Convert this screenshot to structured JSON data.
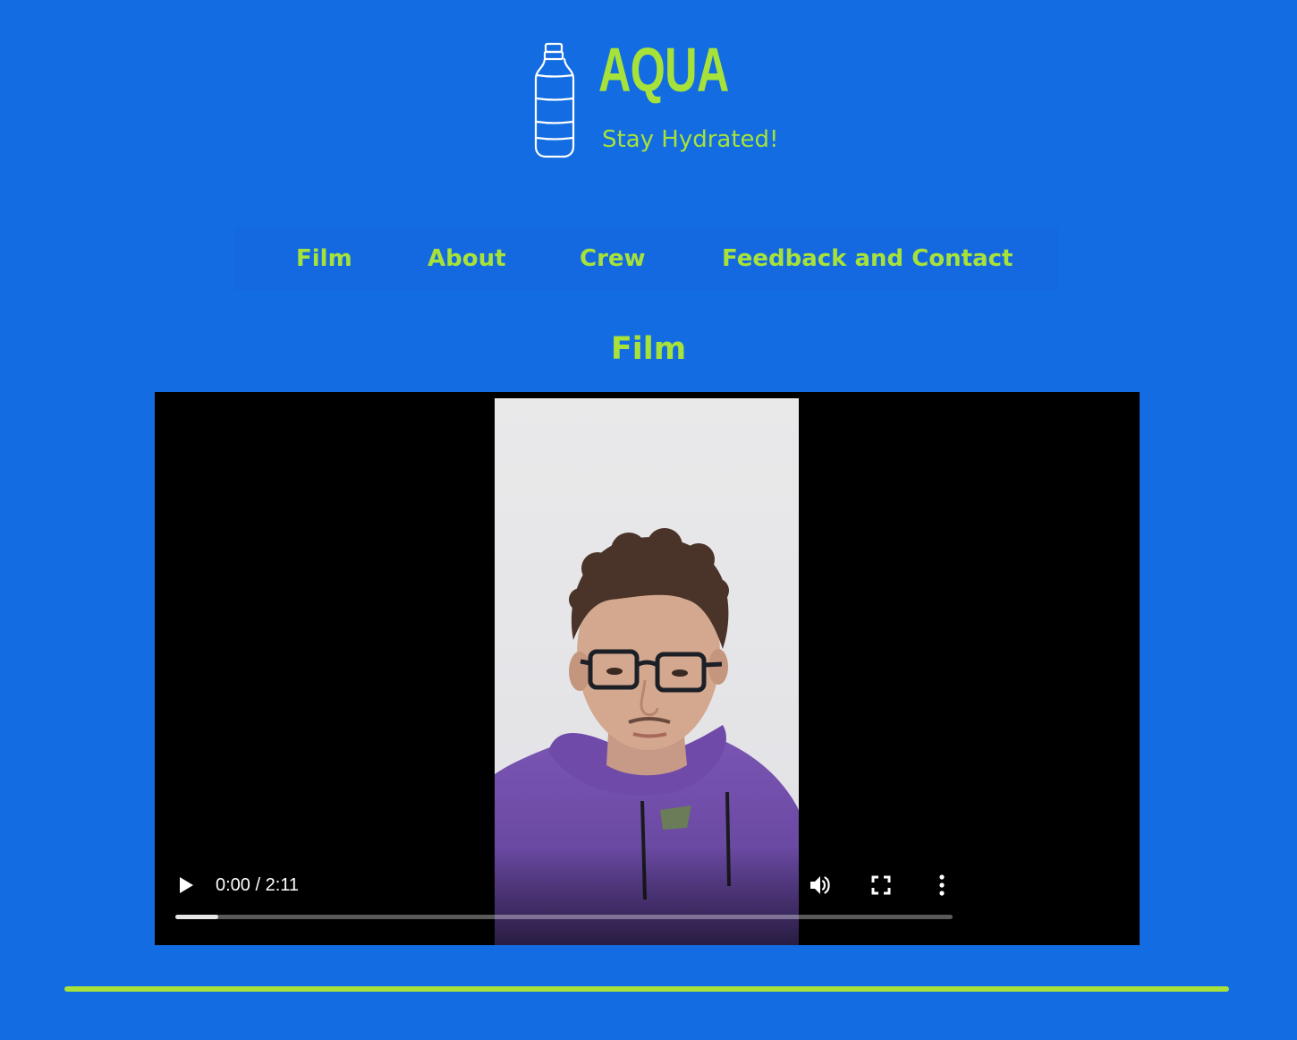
{
  "header": {
    "brand_title": "AQUA",
    "tagline": "Stay Hydrated!",
    "logo_icon": "water-bottle-icon"
  },
  "nav": {
    "items": [
      {
        "label": "Film"
      },
      {
        "label": "About"
      },
      {
        "label": "Crew"
      },
      {
        "label": "Feedback and Contact"
      }
    ]
  },
  "main": {
    "section_title": "Film",
    "video": {
      "current_time": "0:00",
      "duration": "2:11",
      "time_display": "0:00 / 2:11",
      "buffered_fraction": 0.055,
      "icons": {
        "play": "play-icon",
        "volume": "volume-icon",
        "fullscreen": "fullscreen-icon",
        "more": "more-vertical-icon"
      }
    }
  },
  "colors": {
    "background": "#136ce1",
    "accent": "#a6e23a",
    "player_bg": "#000000"
  }
}
